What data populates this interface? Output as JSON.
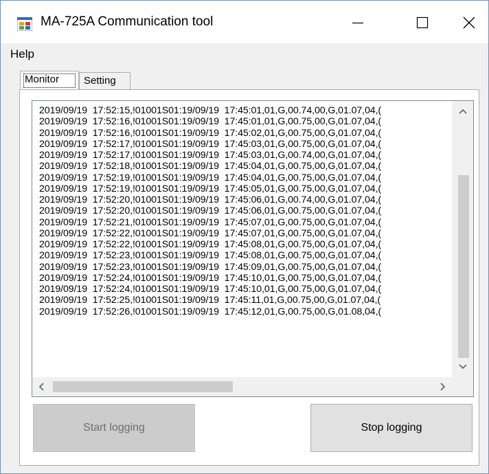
{
  "window": {
    "title": "MA-725A Communication tool",
    "icons": {
      "app": "app-window-icon",
      "minimize": "minimize-icon",
      "maximize": "maximize-icon",
      "close": "close-icon"
    }
  },
  "menu": {
    "help": "Help"
  },
  "tabs": [
    {
      "label": "Monitor",
      "selected": true
    },
    {
      "label": "Setting",
      "selected": false
    }
  ],
  "log": {
    "lines": [
      "2019/09/19  17:52:15,!01001S01:19/09/19  17:45:01,01,G,00.74,00,G,01.07,04,(",
      "2019/09/19  17:52:16,!01001S01:19/09/19  17:45:01,01,G,00.75,00,G,01.07,04,(",
      "2019/09/19  17:52:16,!01001S01:19/09/19  17:45:02,01,G,00.75,00,G,01.07,04,(",
      "2019/09/19  17:52:17,!01001S01:19/09/19  17:45:03,01,G,00.75,00,G,01.07,04,(",
      "2019/09/19  17:52:17,!01001S01:19/09/19  17:45:03,01,G,00.74,00,G,01.07,04,(",
      "2019/09/19  17:52:18,!01001S01:19/09/19  17:45:04,01,G,00.75,00,G,01.07,04,(",
      "2019/09/19  17:52:19,!01001S01:19/09/19  17:45:04,01,G,00.75,00,G,01.07,04,(",
      "2019/09/19  17:52:19,!01001S01:19/09/19  17:45:05,01,G,00.75,00,G,01.07,04,(",
      "2019/09/19  17:52:20,!01001S01:19/09/19  17:45:06,01,G,00.74,00,G,01.07,04,(",
      "2019/09/19  17:52:20,!01001S01:19/09/19  17:45:06,01,G,00.75,00,G,01.07,04,(",
      "2019/09/19  17:52:21,!01001S01:19/09/19  17:45:07,01,G,00.75,00,G,01.07,04,(",
      "2019/09/19  17:52:22,!01001S01:19/09/19  17:45:07,01,G,00.75,00,G,01.07,04,(",
      "2019/09/19  17:52:22,!01001S01:19/09/19  17:45:08,01,G,00.75,00,G,01.07,04,(",
      "2019/09/19  17:52:23,!01001S01:19/09/19  17:45:08,01,G,00.75,00,G,01.07,04,(",
      "2019/09/19  17:52:23,!01001S01:19/09/19  17:45:09,01,G,00.75,00,G,01.07,04,(",
      "2019/09/19  17:52:24,!01001S01:19/09/19  17:45:10,01,G,00.75,00,G,01.07,04,(",
      "2019/09/19  17:52:24,!01001S01:19/09/19  17:45:10,01,G,00.75,00,G,01.07,04,(",
      "2019/09/19  17:52:25,!01001S01:19/09/19  17:45:11,01,G,00.75,00,G,01.07,04,(",
      "2019/09/19  17:52:26,!01001S01:19/09/19  17:45:12,01,G,00.75,00,G,01.08,04,("
    ]
  },
  "buttons": {
    "start": {
      "label": "Start logging",
      "enabled": false
    },
    "stop": {
      "label": "Stop logging",
      "enabled": true
    }
  },
  "colors": {
    "window_border": "#6e8fb8",
    "background": "#f0f0f0",
    "scroll_thumb": "#cdcdcd",
    "disabled_button": "#cccccc"
  }
}
